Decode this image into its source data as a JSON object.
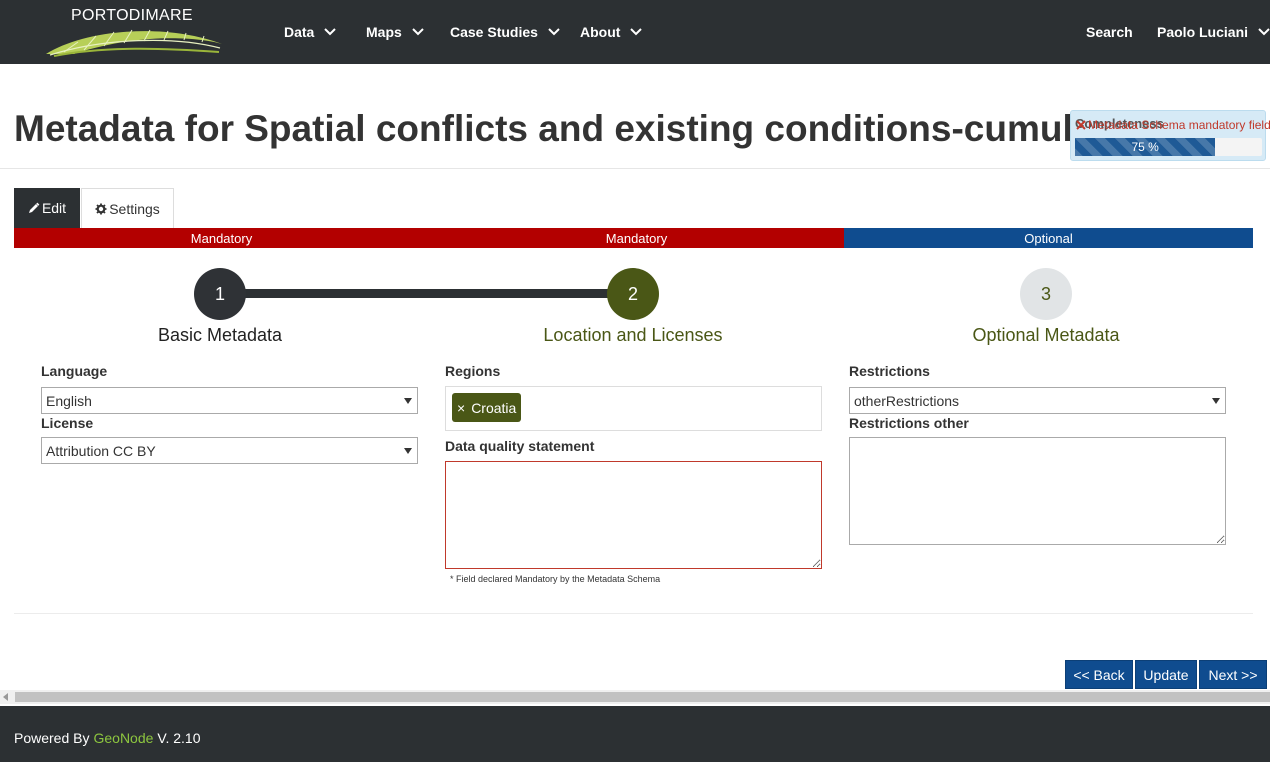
{
  "navbar": {
    "brand": "PORTODIMARE",
    "items": [
      {
        "label": "Data"
      },
      {
        "label": "Maps"
      },
      {
        "label": "Case Studies"
      },
      {
        "label": "About"
      }
    ],
    "search": "Search",
    "user": "Paolo Luciani"
  },
  "page": {
    "title": "Metadata for Spatial conflicts and existing conditions-cumulative"
  },
  "completeness": {
    "label": "Completeness",
    "warning": "Metadata Schema mandatory fields",
    "percent_text": "75 %",
    "percent_value": 75
  },
  "tabs": {
    "edit": "Edit",
    "settings": "Settings"
  },
  "wizard": {
    "bar": [
      "Mandatory",
      "Mandatory",
      "Optional"
    ],
    "steps": [
      {
        "number": "1",
        "label": "Basic Metadata"
      },
      {
        "number": "2",
        "label": "Location and Licenses"
      },
      {
        "number": "3",
        "label": "Optional Metadata"
      }
    ]
  },
  "form": {
    "language": {
      "label": "Language",
      "value": "English"
    },
    "license": {
      "label": "License",
      "value": "Attribution CC BY"
    },
    "regions": {
      "label": "Regions",
      "tags": [
        "Croatia"
      ]
    },
    "data_quality": {
      "label": "Data quality statement",
      "value": ""
    },
    "mandatory_note": "* Field declared Mandatory by the Metadata Schema",
    "restrictions": {
      "label": "Restrictions",
      "value": "otherRestrictions"
    },
    "restrictions_other": {
      "label": "Restrictions other",
      "value": ""
    }
  },
  "buttons": {
    "back": "<< Back",
    "update": "Update",
    "next": "Next >>"
  },
  "footer": {
    "prefix": "Powered By",
    "link": "GeoNode",
    "suffix": "V. 2.10"
  },
  "colors": {
    "navbar": "#2c3033",
    "mandatory": "#b30000",
    "optional": "#0f4c8f",
    "accent_green": "#4a5716",
    "footer_link": "#8dc63f"
  }
}
